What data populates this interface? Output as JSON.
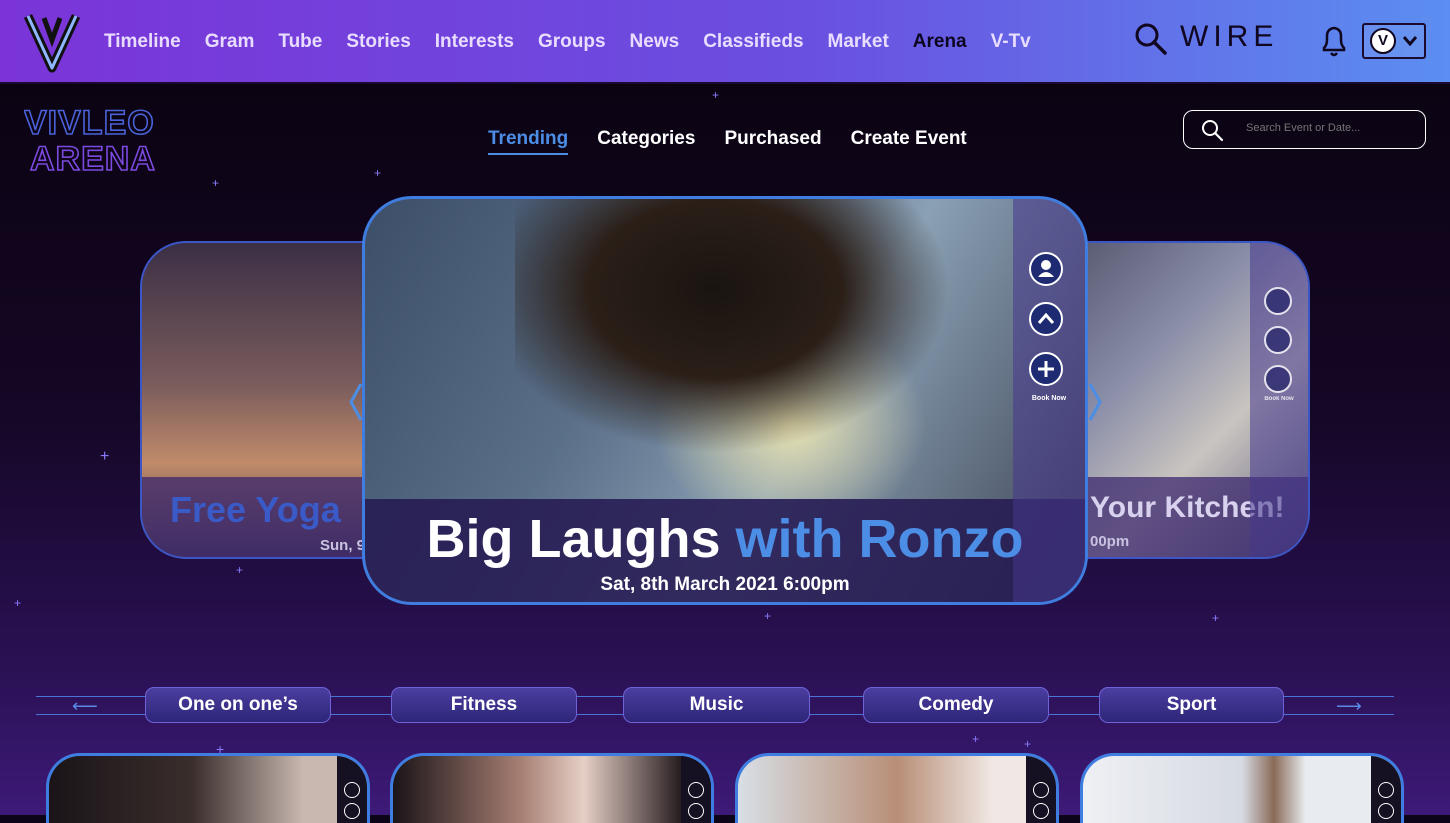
{
  "nav": {
    "items": [
      "Timeline",
      "Gram",
      "Tube",
      "Stories",
      "Interests",
      "Groups",
      "News",
      "Classifieds",
      "Market",
      "Arena",
      "V-Tv"
    ],
    "active_item": "Arena",
    "wire_label": "WIRE"
  },
  "avatar": {
    "initial": "V"
  },
  "arena": {
    "logo_line1": "VIVLEO",
    "logo_line2": "ARENA",
    "tabs": [
      "Trending",
      "Categories",
      "Purchased",
      "Create Event"
    ],
    "active_tab": "Trending",
    "search_placeholder": "Search Event or Date..."
  },
  "carousel": {
    "left": {
      "title": "Free Yoga",
      "date": "Sun, 9"
    },
    "main": {
      "title_white": "Big Laughs",
      "title_blue": "with Ronzo",
      "date": "Sat, 8th March 2021 6:00pm"
    },
    "right": {
      "title": "Your Kitchen!",
      "date": "00pm"
    },
    "book_now_label": "Book Now"
  },
  "categories": [
    "One on one’s",
    "Fitness",
    "Music",
    "Comedy",
    "Sport"
  ],
  "colors": {
    "accent": "#4c8ee6",
    "nav_bg_start": "#7b34d8",
    "nav_bg_end": "#5b8ef0",
    "panel": "#2d2678"
  }
}
